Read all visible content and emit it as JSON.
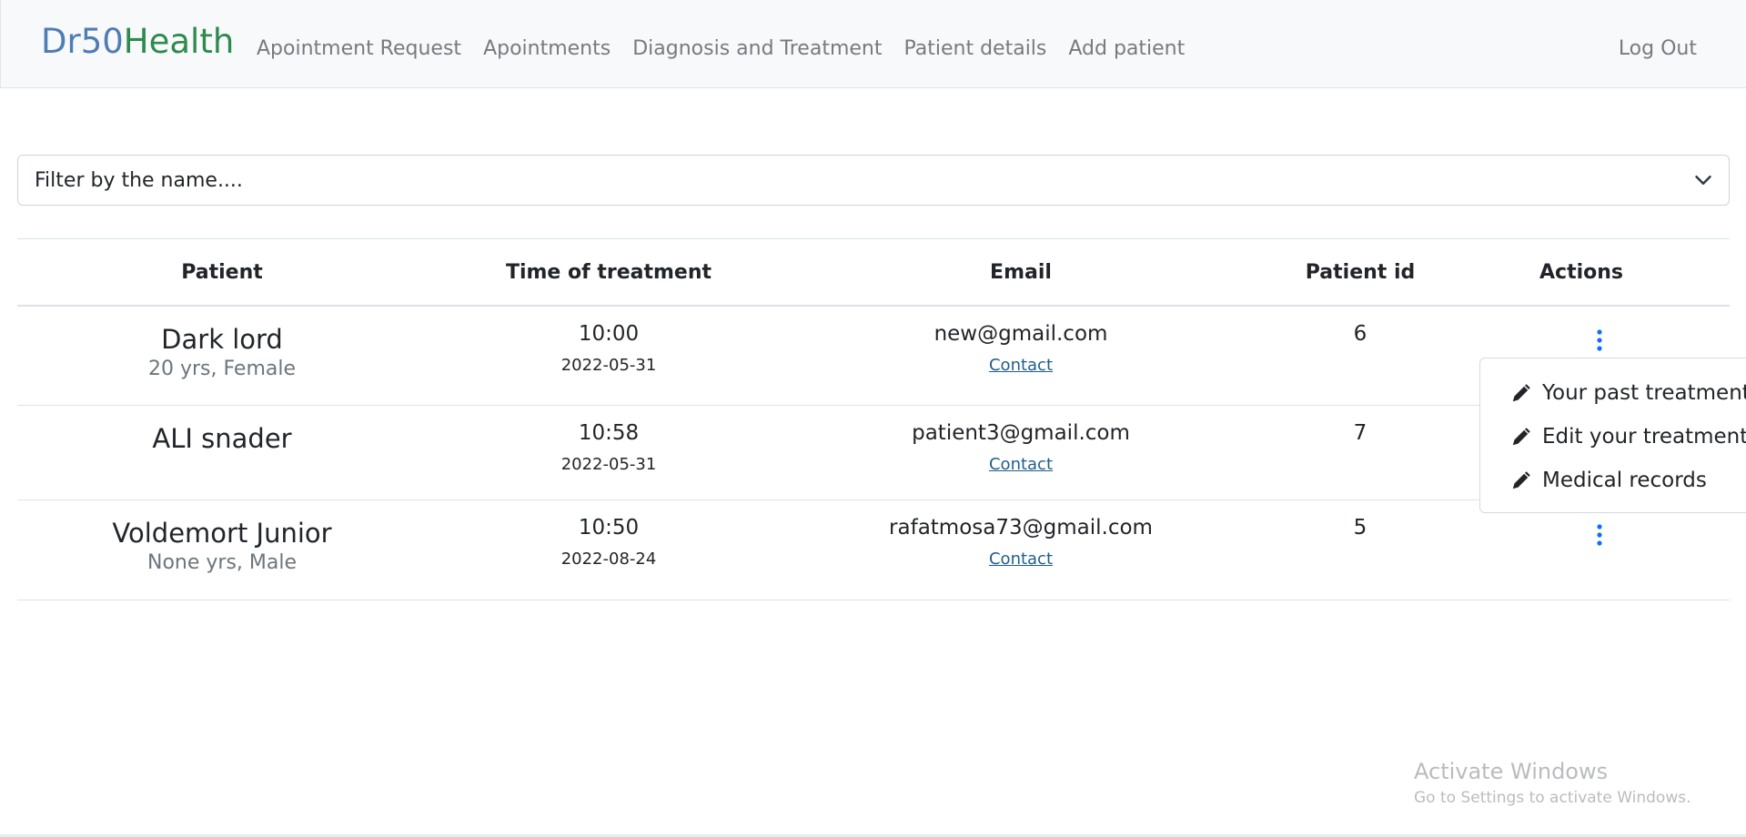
{
  "navbar": {
    "brand_part1": "Dr50",
    "brand_part2": "Health",
    "brand_colors": {
      "part1": "#4f7db6",
      "part2": "#2f8a4e"
    },
    "links": [
      {
        "label": "Apointment Request"
      },
      {
        "label": "Apointments"
      },
      {
        "label": "Diagnosis and Treatment"
      },
      {
        "label": "Patient details"
      },
      {
        "label": "Add patient"
      }
    ],
    "logout_label": "Log Out"
  },
  "filter": {
    "selected": "Filter by the name....",
    "icon": "chevron-down-icon"
  },
  "table": {
    "headers": [
      "Patient",
      "Time of treatment",
      "Email",
      "Patient id",
      "Actions"
    ],
    "rows": [
      {
        "name": "Dark lord",
        "info": "20 yrs, Female",
        "time": "10:00",
        "date": "2022-05-31",
        "email": "new@gmail.com",
        "contact": "Contact",
        "id": "6",
        "actions_icon": "kebab-menu-icon"
      },
      {
        "name": "ALI snader",
        "info": "",
        "time": "10:58",
        "date": "2022-05-31",
        "email": "patient3@gmail.com",
        "contact": "Contact",
        "id": "7",
        "actions_icon": "kebab-menu-icon"
      },
      {
        "name": "Voldemort Junior",
        "info": "None yrs, Male",
        "time": "10:50",
        "date": "2022-08-24",
        "email": "rafatmosa73@gmail.com",
        "contact": "Contact",
        "id": "5",
        "actions_icon": "kebab-menu-icon"
      }
    ]
  },
  "actions_dropdown": {
    "items": [
      {
        "label": "Your past treatments",
        "icon": "pencil-icon"
      },
      {
        "label": "Edit your treatment",
        "icon": "pencil-icon"
      },
      {
        "label": "Medical records",
        "icon": "pencil-icon"
      }
    ]
  },
  "watermark": {
    "title": "Activate Windows",
    "subtitle": "Go to Settings to activate Windows."
  },
  "colors": {
    "accent_blue": "#0d6efd",
    "link": "#1f5f8b"
  }
}
